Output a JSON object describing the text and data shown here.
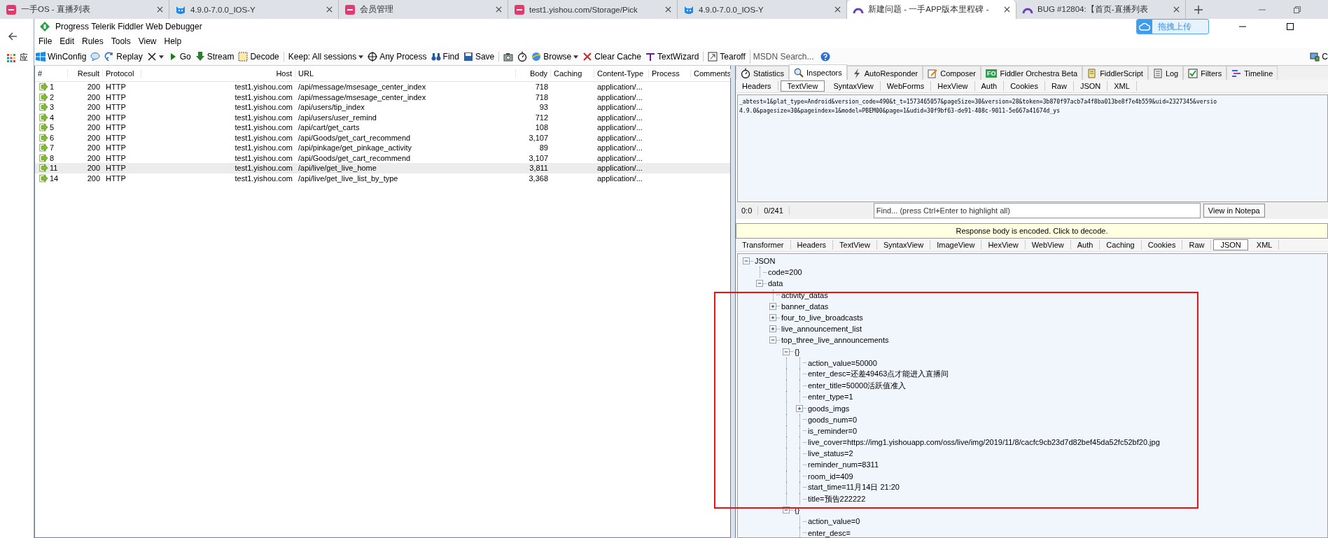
{
  "browser": {
    "tabs": [
      {
        "kind": "app",
        "title": "一手OS - 直播列表",
        "selected": false
      },
      {
        "kind": "mascot",
        "title": "4.9.0-7.0.0_IOS-Y",
        "selected": false
      },
      {
        "kind": "app",
        "title": "会员管理",
        "selected": false
      },
      {
        "kind": "app",
        "title": "test1.yishou.com/Storage/Pick",
        "selected": false
      },
      {
        "kind": "mascot",
        "title": "4.9.0-7.0.0_IOS-Y",
        "selected": false
      },
      {
        "kind": "ring",
        "title": "新建问题 - 一手APP版本里程碑 -",
        "selected": true
      },
      {
        "kind": "ring",
        "title": "BUG #12804:【首页-直播列表",
        "selected": false
      }
    ],
    "bookmark": "应"
  },
  "fiddler": {
    "title": "Progress Telerik Fiddler Web Debugger",
    "upload_button": "拖拽上传",
    "menu": [
      "File",
      "Edit",
      "Rules",
      "Tools",
      "View",
      "Help"
    ],
    "toolbar": [
      {
        "kind": "button",
        "label": "WinConfig"
      },
      {
        "kind": "icon"
      },
      {
        "kind": "button",
        "label": "Replay"
      },
      {
        "kind": "dropdown"
      },
      {
        "kind": "button",
        "label": "Go"
      },
      {
        "kind": "button",
        "label": "Stream"
      },
      {
        "kind": "button",
        "label": "Decode"
      },
      {
        "kind": "dropdown",
        "label": "Keep: All sessions"
      },
      {
        "kind": "button",
        "label": "Any Process"
      },
      {
        "kind": "button",
        "label": "Find"
      },
      {
        "kind": "button",
        "label": "Save"
      },
      {
        "kind": "icon"
      },
      {
        "kind": "icon"
      },
      {
        "kind": "dropdown",
        "label": "Browse"
      },
      {
        "kind": "button",
        "label": "Clear Cache"
      },
      {
        "kind": "button",
        "label": "TextWizard"
      },
      {
        "kind": "button",
        "label": "Tearoff"
      },
      {
        "kind": "search",
        "placeholder": "MSDN Search..."
      },
      {
        "kind": "icon"
      }
    ],
    "toolbar_edge": "C",
    "sessions": {
      "columns": [
        "#",
        "Result",
        "Protocol",
        "Host",
        "URL",
        "Body",
        "Caching",
        "Content-Type",
        "Process",
        "Comments"
      ],
      "rows": [
        {
          "num": "1",
          "result": "200",
          "protocol": "HTTP",
          "host": "test1.yishou.com",
          "url": "/api/message/msesage_center_index",
          "body": "718",
          "content_type": "application/...",
          "selected": false
        },
        {
          "num": "2",
          "result": "200",
          "protocol": "HTTP",
          "host": "test1.yishou.com",
          "url": "/api/message/msesage_center_index",
          "body": "718",
          "content_type": "application/...",
          "selected": false
        },
        {
          "num": "3",
          "result": "200",
          "protocol": "HTTP",
          "host": "test1.yishou.com",
          "url": "/api/users/tip_index",
          "body": "93",
          "content_type": "application/...",
          "selected": false
        },
        {
          "num": "4",
          "result": "200",
          "protocol": "HTTP",
          "host": "test1.yishou.com",
          "url": "/api/users/user_remind",
          "body": "712",
          "content_type": "application/...",
          "selected": false
        },
        {
          "num": "5",
          "result": "200",
          "protocol": "HTTP",
          "host": "test1.yishou.com",
          "url": "/api/cart/get_carts",
          "body": "108",
          "content_type": "application/...",
          "selected": false
        },
        {
          "num": "6",
          "result": "200",
          "protocol": "HTTP",
          "host": "test1.yishou.com",
          "url": "/api/Goods/get_cart_recommend",
          "body": "3,107",
          "content_type": "application/...",
          "selected": false
        },
        {
          "num": "7",
          "result": "200",
          "protocol": "HTTP",
          "host": "test1.yishou.com",
          "url": "/api/pinkage/get_pinkage_activity",
          "body": "89",
          "content_type": "application/...",
          "selected": false
        },
        {
          "num": "8",
          "result": "200",
          "protocol": "HTTP",
          "host": "test1.yishou.com",
          "url": "/api/Goods/get_cart_recommend",
          "body": "3,107",
          "content_type": "application/...",
          "selected": false
        },
        {
          "num": "11",
          "result": "200",
          "protocol": "HTTP",
          "host": "test1.yishou.com",
          "url": "/api/live/get_live_home",
          "body": "3,811",
          "content_type": "application/...",
          "selected": true
        },
        {
          "num": "14",
          "result": "200",
          "protocol": "HTTP",
          "host": "test1.yishou.com",
          "url": "/api/live/get_live_list_by_type",
          "body": "3,368",
          "content_type": "application/...",
          "selected": false
        }
      ]
    },
    "inspector_tabs": [
      {
        "label": "Statistics",
        "selected": false
      },
      {
        "label": "Inspectors",
        "selected": true
      },
      {
        "label": "AutoResponder",
        "selected": false
      },
      {
        "label": "Composer",
        "selected": false
      },
      {
        "label": "Fiddler Orchestra Beta",
        "badge": "FO",
        "selected": false
      },
      {
        "label": "FiddlerScript",
        "selected": false
      },
      {
        "label": "Log",
        "selected": false
      },
      {
        "label": "Filters",
        "selected": false
      },
      {
        "label": "Timeline",
        "selected": false
      }
    ],
    "request_tabs": [
      {
        "label": "Headers",
        "selected": false
      },
      {
        "label": "TextView",
        "selected": true
      },
      {
        "label": "SyntaxView",
        "selected": false
      },
      {
        "label": "WebForms",
        "selected": false
      },
      {
        "label": "HexView",
        "selected": false
      },
      {
        "label": "Auth",
        "selected": false
      },
      {
        "label": "Cookies",
        "selected": false
      },
      {
        "label": "Raw",
        "selected": false
      },
      {
        "label": "JSON",
        "selected": false
      },
      {
        "label": "XML",
        "selected": false
      }
    ],
    "request_text": [
      "_abtest=1&plat_type=Android&version_code=490&t_t=1573465057&pageSize=30&version=28&token=3b870f97acb7a4f8ba013be8f7e4b559&uid=2327345&versio",
      "4.9.0&pagesize=30&pageindex=1&model=PBEM00&page=1&udid=30f9bf63-de91-408c-9011-5e667a41674d_ys"
    ],
    "status": {
      "position": "0:0",
      "count": "0/241",
      "find_placeholder": "Find... (press Ctrl+Enter to highlight all)",
      "notepad_button": "View in Notepa"
    },
    "banner": "Response body is encoded. Click to decode.",
    "response_tabs": [
      {
        "label": "Transformer",
        "selected": false
      },
      {
        "label": "Headers",
        "selected": false
      },
      {
        "label": "TextView",
        "selected": false
      },
      {
        "label": "SyntaxView",
        "selected": false
      },
      {
        "label": "ImageView",
        "selected": false
      },
      {
        "label": "HexView",
        "selected": false
      },
      {
        "label": "WebView",
        "selected": false
      },
      {
        "label": "Auth",
        "selected": false
      },
      {
        "label": "Caching",
        "selected": false
      },
      {
        "label": "Cookies",
        "selected": false
      },
      {
        "label": "Raw",
        "selected": false
      },
      {
        "label": "JSON",
        "selected": true
      },
      {
        "label": "XML",
        "selected": false
      }
    ],
    "tree": [
      {
        "kind": "branch",
        "label": "JSON",
        "expanded": true,
        "children": [
          {
            "kind": "leaf",
            "label": "code=200"
          },
          {
            "kind": "branch",
            "label": "data",
            "expanded": true,
            "children": [
              {
                "kind": "leaf",
                "label": "activity_datas"
              },
              {
                "kind": "branch",
                "label": "banner_datas",
                "expanded": false
              },
              {
                "kind": "branch",
                "label": "four_to_live_broadcasts",
                "expanded": false
              },
              {
                "kind": "branch",
                "label": "live_announcement_list",
                "expanded": false
              },
              {
                "kind": "branch",
                "label": "top_three_live_announcements",
                "expanded": true,
                "children": [
                  {
                    "kind": "branch",
                    "label": "{}",
                    "expanded": true,
                    "children": [
                      {
                        "kind": "leaf",
                        "label": "action_value=50000"
                      },
                      {
                        "kind": "leaf",
                        "label": "enter_desc=还差49463点才能进入直播间"
                      },
                      {
                        "kind": "leaf",
                        "label": "enter_title=50000活跃值准入"
                      },
                      {
                        "kind": "leaf",
                        "label": "enter_type=1"
                      },
                      {
                        "kind": "branch",
                        "label": "goods_imgs",
                        "expanded": false
                      },
                      {
                        "kind": "leaf",
                        "label": "goods_num=0"
                      },
                      {
                        "kind": "leaf",
                        "label": "is_reminder=0"
                      },
                      {
                        "kind": "leaf",
                        "label": "live_cover=https://img1.yishouapp.com/oss/live/img/2019/11/8/cacfc9cb23d7d82bef45da52fc52bf20.jpg"
                      },
                      {
                        "kind": "leaf",
                        "label": "live_status=2"
                      },
                      {
                        "kind": "leaf",
                        "label": "reminder_num=8311"
                      },
                      {
                        "kind": "leaf",
                        "label": "room_id=409"
                      },
                      {
                        "kind": "leaf",
                        "label": "start_time=11月14日 21:20"
                      },
                      {
                        "kind": "leaf",
                        "label": "title=预告222222"
                      }
                    ]
                  },
                  {
                    "kind": "branch",
                    "label": "{}",
                    "expanded": true,
                    "children": [
                      {
                        "kind": "leaf",
                        "label": "action_value=0"
                      },
                      {
                        "kind": "leaf",
                        "label": "enter_desc="
                      }
                    ]
                  }
                ]
              }
            ]
          }
        ]
      }
    ]
  }
}
